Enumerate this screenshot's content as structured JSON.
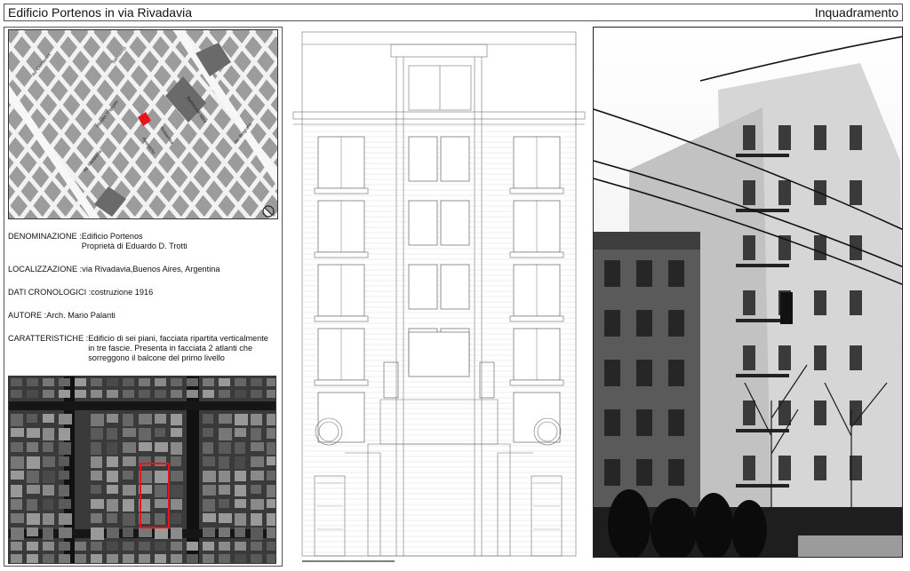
{
  "header": {
    "title": "Edificio Portenos  in via Rivadavia",
    "section": "Inquadramento"
  },
  "map": {
    "streets": {
      "corrientes": "Av. Corrientes",
      "sarmiento": "Sarmiento",
      "hipolito": "Hipolito Yrigoyen",
      "rivadavia": "Av. Rivadavia",
      "ayacucho": "Ayacucho",
      "riobamba": "Riobamba",
      "bartolome": "Bartolome Mitre",
      "belgrano": "Av. Belgrano"
    },
    "highlight_color": "#e8141b"
  },
  "info": {
    "denominazione_label": "DENOMINAZIONE : ",
    "denominazione_value": "Edificio Portenos\nProprietà di Eduardo D. Trotti",
    "localizzazione_label": "LOCALIZZAZIONE : ",
    "localizzazione_value": "via Rivadavia,Buenos Aires, Argentina",
    "dati_label": "DATI CRONOLOGICI : ",
    "dati_value": "costruzione 1916",
    "autore_label": "AUTORE : ",
    "autore_value": "Arch. Mario Palanti",
    "caratteristiche_label": "CARATTERISTICHE : ",
    "caratteristiche_value": "Edificio di sei piani, facciata ripartita verticalmente\nin tre fascie. Presenta in facciata 2 atlanti che\nsorreggono il balcone del primo livello"
  },
  "aerial": {
    "marker_color": "#e8141b"
  },
  "icons": {
    "north": "north-arrow-icon"
  }
}
